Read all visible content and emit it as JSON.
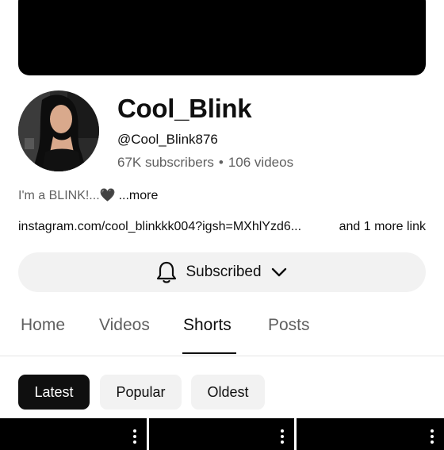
{
  "channel": {
    "name": "Cool_Blink",
    "handle": "@Cool_Blink876",
    "subscribers": "67K subscribers",
    "separator": "•",
    "videos": "106 videos",
    "description": "I'm a BLINK!...🖤",
    "description_more": "...more",
    "link": "instagram.com/cool_blinkkk004?igsh=MXhlYzd6...",
    "more_links": "and 1 more link"
  },
  "subscribe_button": {
    "label": "Subscribed",
    "icon": "bell-icon",
    "dropdown_icon": "chevron-down-icon"
  },
  "tabs": [
    {
      "label": "Home",
      "active": false
    },
    {
      "label": "Videos",
      "active": false
    },
    {
      "label": "Shorts",
      "active": true
    },
    {
      "label": "Posts",
      "active": false
    }
  ],
  "filters": [
    {
      "label": "Latest",
      "selected": true
    },
    {
      "label": "Popular",
      "selected": false
    },
    {
      "label": "Oldest",
      "selected": false
    }
  ],
  "colors": {
    "text_primary": "#0f0f0f",
    "text_secondary": "#606060",
    "chip_bg": "#f2f2f2",
    "chip_selected_bg": "#0f0f0f"
  }
}
